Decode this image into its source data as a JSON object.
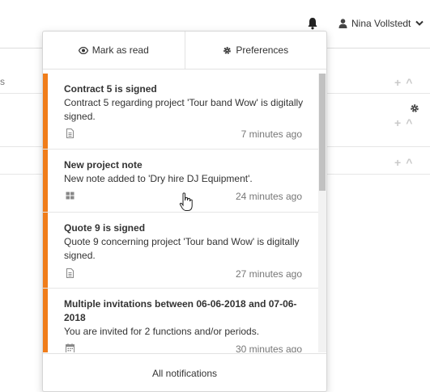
{
  "header": {
    "bell_icon": "bell-icon",
    "user_icon": "user-icon",
    "user_name": "Nina Vollstedt",
    "chevron_icon": "chevron-down-icon"
  },
  "background": {
    "side_label": "s",
    "settings_icon": "gear-icon"
  },
  "notifications": {
    "mark_as_read_label": "Mark as read",
    "mark_as_read_icon": "eye-icon",
    "preferences_label": "Preferences",
    "preferences_icon": "gear-icon",
    "items": [
      {
        "title": "Contract 5 is signed",
        "text": "Contract 5 regarding project 'Tour band Wow' is digitally signed.",
        "icon": "document-icon",
        "time": "7 minutes ago"
      },
      {
        "title": "New project note",
        "text": "New note added to 'Dry hire DJ Equipment'.",
        "icon": "grid-icon",
        "time": "24 minutes ago"
      },
      {
        "title": "Quote 9 is signed",
        "text": "Quote 9 concerning project 'Tour band Wow' is digitally signed.",
        "icon": "document-icon",
        "time": "27 minutes ago"
      },
      {
        "title": "Multiple invitations between 06-06-2018 and 07-06-2018",
        "text": "You are invited for 2 functions and/or periods.",
        "icon": "calendar-icon",
        "time": "30 minutes ago"
      }
    ],
    "footer_label": "All notifications"
  },
  "colors": {
    "accent": "#f07d1a"
  }
}
